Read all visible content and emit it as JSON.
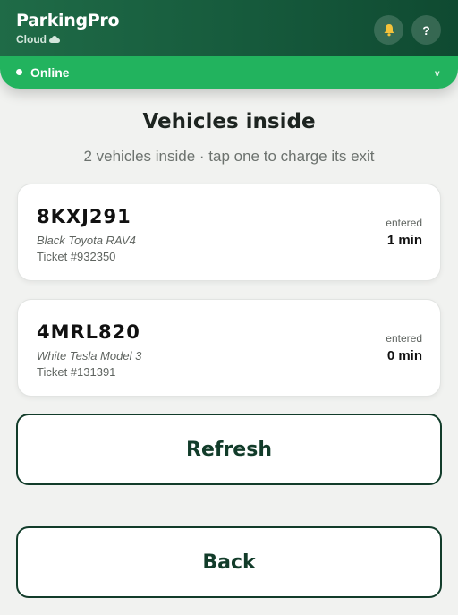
{
  "header": {
    "title": "ParkingPro",
    "subtitle": "Cloud",
    "notifications_icon": "bell-icon",
    "help_label": "?"
  },
  "status": {
    "label": "Online",
    "chevron": "v",
    "color": "#22b35e"
  },
  "page": {
    "title": "Vehicles inside",
    "subtitle": "2 vehicles inside · tap one to charge its exit"
  },
  "vehicles": [
    {
      "plate": "8KXJ291",
      "description": "Black Toyota RAV4",
      "ticket": "Ticket #932350",
      "entered_label": "entered",
      "entered_time": "1 min"
    },
    {
      "plate": "4MRL820",
      "description": "White Tesla Model 3",
      "ticket": "Ticket #131391",
      "entered_label": "entered",
      "entered_time": "0 min"
    }
  ],
  "actions": {
    "refresh_label": "Refresh",
    "back_label": "Back"
  },
  "colors": {
    "brand_dark": "#165a3c",
    "accent": "#123c2a"
  }
}
